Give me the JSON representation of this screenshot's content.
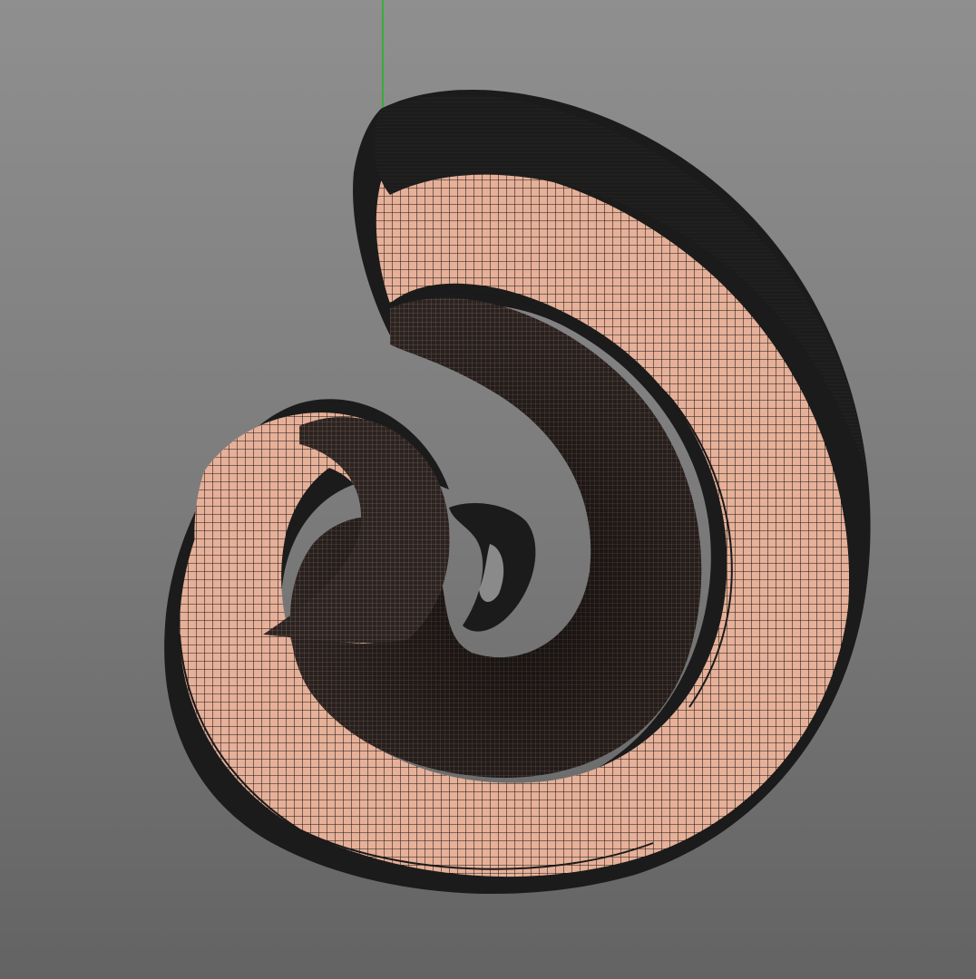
{
  "viewport": {
    "mode": "wireframe-on-shaded",
    "background_top": "#8f8f8f",
    "background_bottom": "#636363"
  },
  "model": {
    "shape": "shell-spiral",
    "surface_color": "#e7b098",
    "wire_color": "#1a1a1a"
  },
  "axis": {
    "y_axis_color": "#22b422"
  }
}
